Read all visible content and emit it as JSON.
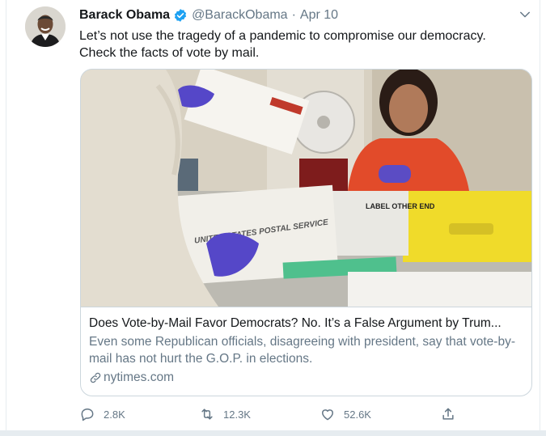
{
  "tweet": {
    "author_name": "Barack Obama",
    "handle": "@BarackObama",
    "separator": "·",
    "time": "Apr 10",
    "text_line1": "Let’s not use the tragedy of a pandemic to compromise our democracy.",
    "text_line2": "Check the facts of vote by mail."
  },
  "card": {
    "title": "Does Vote-by-Mail Favor Democrats? No. It’s a False Argument by Trum...",
    "description": "Even some Republican officials, disagreeing with president, say that vote-by-mail has not hurt the G.O.P. in elections.",
    "domain": "nytimes.com",
    "envelope_text": "UNITED STATES POSTAL SERVICE",
    "box_label": "LABEL OTHER END"
  },
  "actions": {
    "reply_count": "2.8K",
    "retweet_count": "12.3K",
    "like_count": "52.6K"
  },
  "colors": {
    "text_primary": "#14171a",
    "text_secondary": "#657786",
    "verified_blue": "#1da1f2",
    "border": "#ccd6dd"
  },
  "icons": [
    "verified-badge-icon",
    "caret-down-icon",
    "link-icon",
    "reply-icon",
    "retweet-icon",
    "like-icon",
    "share-icon"
  ]
}
